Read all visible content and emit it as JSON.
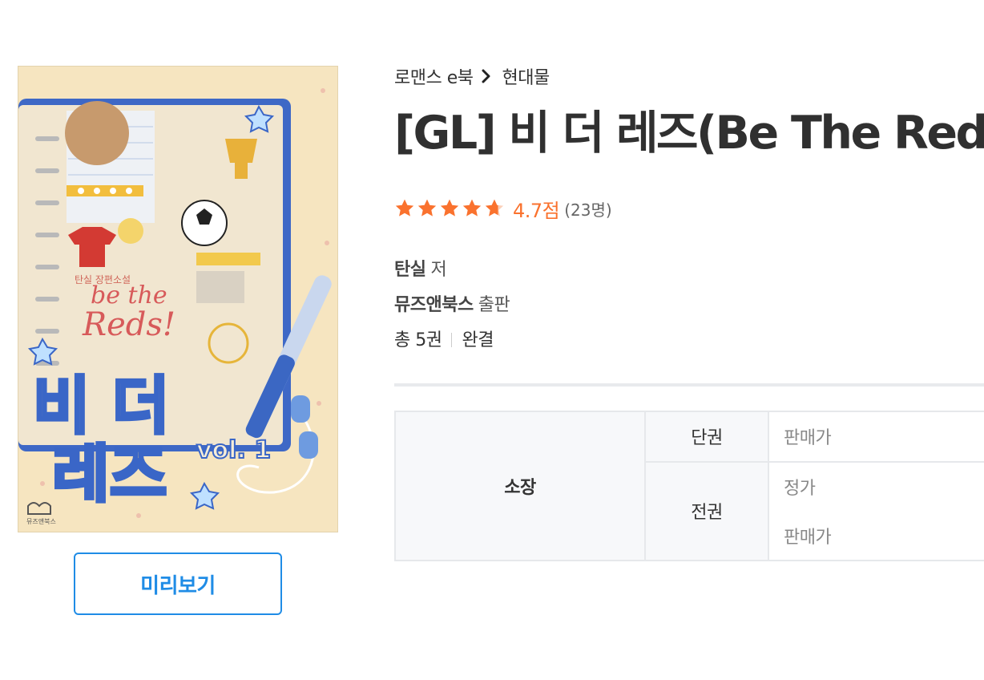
{
  "breadcrumb": {
    "category": "로맨스 e북",
    "subcategory": "현대물",
    "separator_icon": "chevron-right-icon"
  },
  "book": {
    "title": "[GL] 비 더 레즈(Be The Reds)",
    "rating": {
      "stars_filled_fraction": 0.94,
      "score": "4.7점",
      "count": "(23명)",
      "star_color": "#fa722e"
    },
    "author": {
      "name": "탄실",
      "suffix": "저"
    },
    "publisher": {
      "name": "뮤즈앤북스",
      "suffix": "출판"
    },
    "series": {
      "total": "총 5권",
      "status": "완결"
    }
  },
  "cover": {
    "publisher_mark": "뮤즈앤북스",
    "author_script": "탄실 장편소설",
    "title_en_line1": "be the",
    "title_en_line2": "Reds!",
    "title_ko_line1": "비 더",
    "title_ko_line2": "레즈",
    "volume": "vol. 1"
  },
  "preview_button": {
    "label": "미리보기",
    "color": "#1f8ce6"
  },
  "price_table": {
    "type_label": "소장",
    "single_label": "단권",
    "single_price_label": "판매가",
    "full_label": "전권",
    "full_regular_label": "정가",
    "full_sale_label": "판매가"
  }
}
